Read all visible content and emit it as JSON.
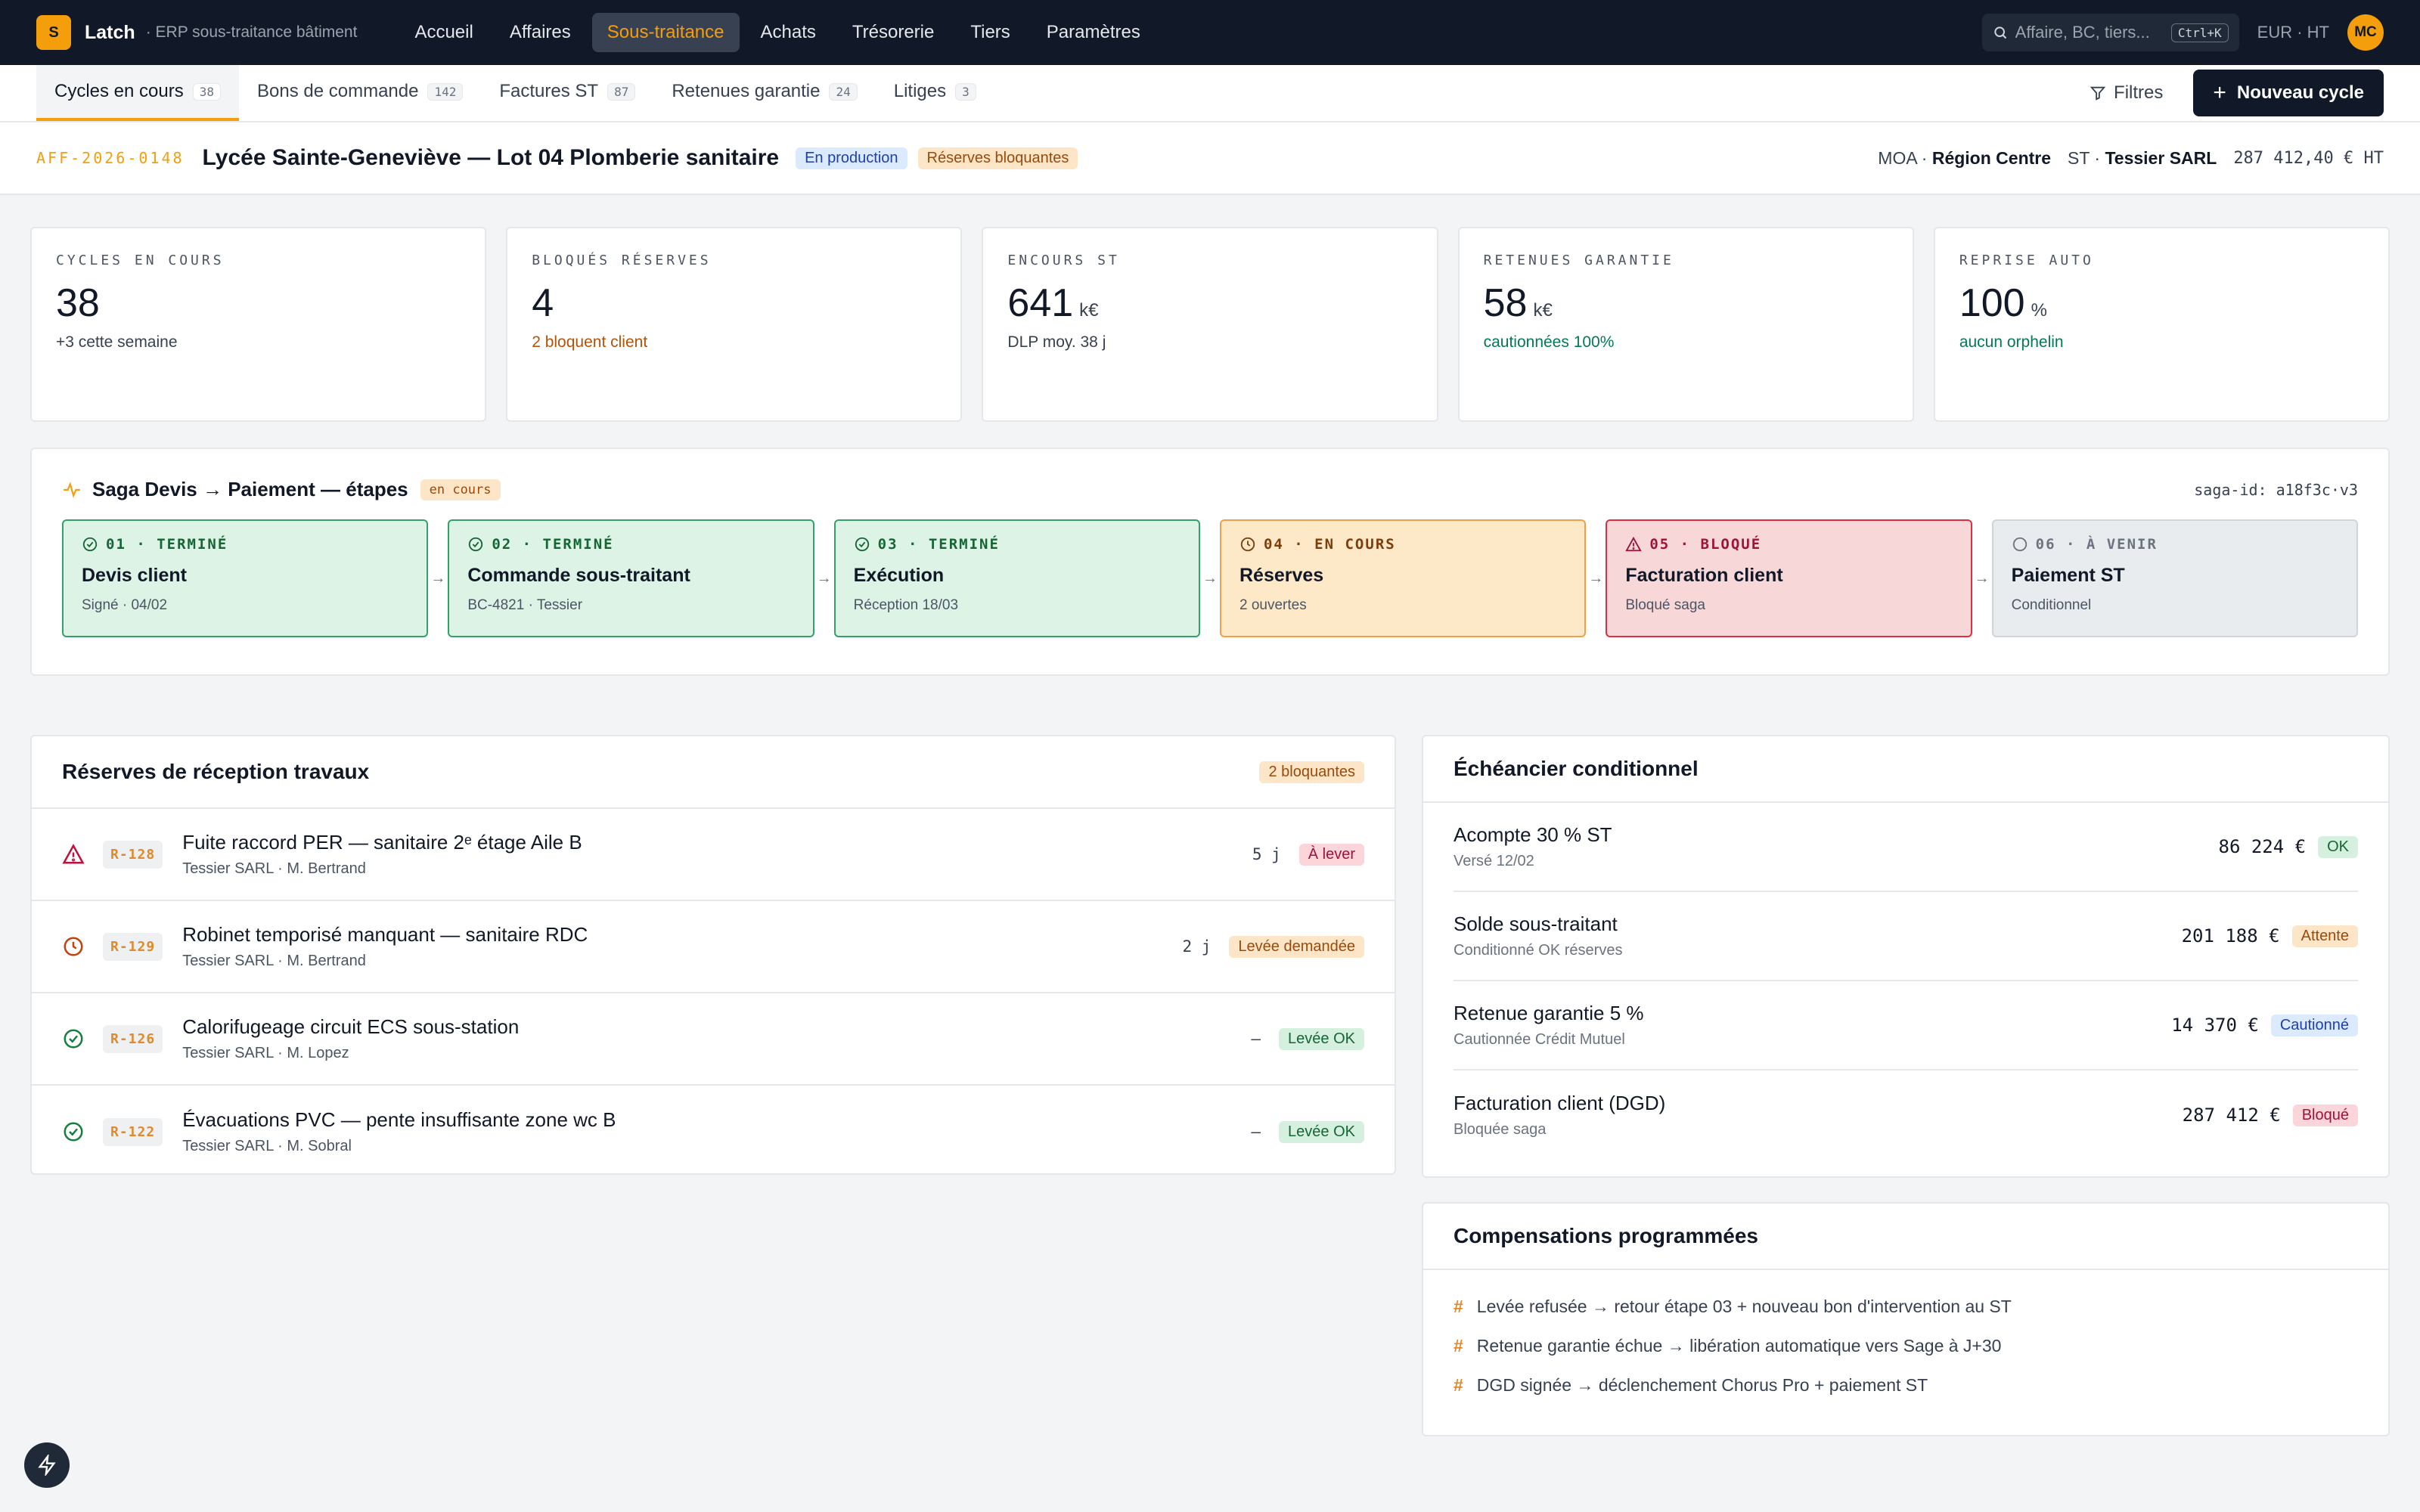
{
  "app": {
    "logo_letter": "S",
    "name": "Latch",
    "subtitle": "· ERP sous-traitance bâtiment"
  },
  "nav": {
    "items": [
      {
        "label": "Accueil"
      },
      {
        "label": "Affaires"
      },
      {
        "label": "Sous-traitance",
        "active": true
      },
      {
        "label": "Achats"
      },
      {
        "label": "Trésorerie"
      },
      {
        "label": "Tiers"
      },
      {
        "label": "Paramètres"
      }
    ]
  },
  "search": {
    "placeholder": "Affaire, BC, tiers...",
    "shortcut": "Ctrl+K"
  },
  "currency": "EUR · HT",
  "user": {
    "initials": "MC"
  },
  "tabs": [
    {
      "label": "Cycles en cours",
      "count": "38",
      "active": true
    },
    {
      "label": "Bons de commande",
      "count": "142"
    },
    {
      "label": "Factures ST",
      "count": "87"
    },
    {
      "label": "Retenues garantie",
      "count": "24"
    },
    {
      "label": "Litiges",
      "count": "3"
    }
  ],
  "toolbar": {
    "filters_label": "Filtres",
    "new_label": "Nouveau cycle"
  },
  "project": {
    "code": "AFF-2026-0148",
    "title": "Lycée Sainte-Geneviève — Lot 04 Plomberie sanitaire",
    "badge_status": "En production",
    "badge_alert": "Réserves bloquantes",
    "moa_label": "MOA ·",
    "moa_value": "Région Centre",
    "st_label": "ST ·",
    "st_value": "Tessier SARL",
    "amount": "287 412,40 € HT"
  },
  "kpis": [
    {
      "label": "CYCLES EN COURS",
      "value": "38",
      "unit": "",
      "sub": "+3 cette semaine",
      "tone": "neutral"
    },
    {
      "label": "BLOQUÉS RÉSERVES",
      "value": "4",
      "unit": "",
      "sub": "2 bloquent client",
      "tone": "warn"
    },
    {
      "label": "ENCOURS ST",
      "value": "641",
      "unit": "k€",
      "sub": "DLP moy. 38 j",
      "tone": "neutral"
    },
    {
      "label": "RETENUES GARANTIE",
      "value": "58",
      "unit": "k€",
      "sub": "cautionnées 100%",
      "tone": "ok"
    },
    {
      "label": "REPRISE AUTO",
      "value": "100",
      "unit": "%",
      "sub": "aucun orphelin",
      "tone": "ok"
    }
  ],
  "saga": {
    "title": "Saga Devis → Paiement — étapes",
    "badge": "en cours",
    "id": "saga-id: a18f3c·v3",
    "steps": [
      {
        "status": "01 · TERMINÉ",
        "name": "Devis client",
        "sub": "Signé · 04/02",
        "state": "done"
      },
      {
        "status": "02 · TERMINÉ",
        "name": "Commande sous-traitant",
        "sub": "BC-4821 · Tessier",
        "state": "done"
      },
      {
        "status": "03 · TERMINÉ",
        "name": "Exécution",
        "sub": "Réception 18/03",
        "state": "done"
      },
      {
        "status": "04 · EN COURS",
        "name": "Réserves",
        "sub": "2 ouvertes",
        "state": "current"
      },
      {
        "status": "05 · BLOQUÉ",
        "name": "Facturation client",
        "sub": "Bloqué saga",
        "state": "blocked"
      },
      {
        "status": "06 · À VENIR",
        "name": "Paiement ST",
        "sub": "Conditionnel",
        "state": "future"
      }
    ]
  },
  "reserves": {
    "title": "Réserves de réception travaux",
    "badge": "2 bloquantes",
    "rows": [
      {
        "code": "R-128",
        "title": "Fuite raccord PER — sanitaire 2ᵉ étage Aile B",
        "sub": "Tessier SARL · M. Bertrand",
        "days": "5 j",
        "status": "À lever",
        "tone": "red",
        "icon": "warning"
      },
      {
        "code": "R-129",
        "title": "Robinet temporisé manquant — sanitaire RDC",
        "sub": "Tessier SARL · M. Bertrand",
        "days": "2 j",
        "status": "Levée demandée",
        "tone": "orange",
        "icon": "clock"
      },
      {
        "code": "R-126",
        "title": "Calorifugeage circuit ECS sous-station",
        "sub": "Tessier SARL · M. Lopez",
        "days": "–",
        "status": "Levée OK",
        "tone": "green",
        "icon": "check"
      },
      {
        "code": "R-122",
        "title": "Évacuations PVC — pente insuffisante zone wc B",
        "sub": "Tessier SARL · M. Sobral",
        "days": "–",
        "status": "Levée OK",
        "tone": "green",
        "icon": "check"
      }
    ]
  },
  "echeancier": {
    "title": "Échéancier conditionnel",
    "rows": [
      {
        "title": "Acompte 30 % ST",
        "sub": "Versé 12/02",
        "amount": "86 224 €",
        "status": "OK",
        "tone": "green"
      },
      {
        "title": "Solde sous-traitant",
        "sub": "Conditionné OK réserves",
        "amount": "201 188 €",
        "status": "Attente",
        "tone": "orange"
      },
      {
        "title": "Retenue garantie 5 %",
        "sub": "Cautionnée Crédit Mutuel",
        "amount": "14 370 €",
        "status": "Cautionné",
        "tone": "blue"
      },
      {
        "title": "Facturation client (DGD)",
        "sub": "Bloquée saga",
        "amount": "287 412 €",
        "status": "Bloqué",
        "tone": "red"
      }
    ]
  },
  "compensations": {
    "title": "Compensations programmées",
    "items": [
      "Levée refusée → retour étape 03 + nouveau bon d'intervention au ST",
      "Retenue garantie échue → libération automatique vers Sage à J+30",
      "DGD signée → déclenchement Chorus Pro + paiement ST"
    ]
  },
  "colors": {
    "accent": "#f59e0b",
    "topbar": "#111827",
    "danger": "#dc2f45",
    "success": "#34a06a"
  }
}
